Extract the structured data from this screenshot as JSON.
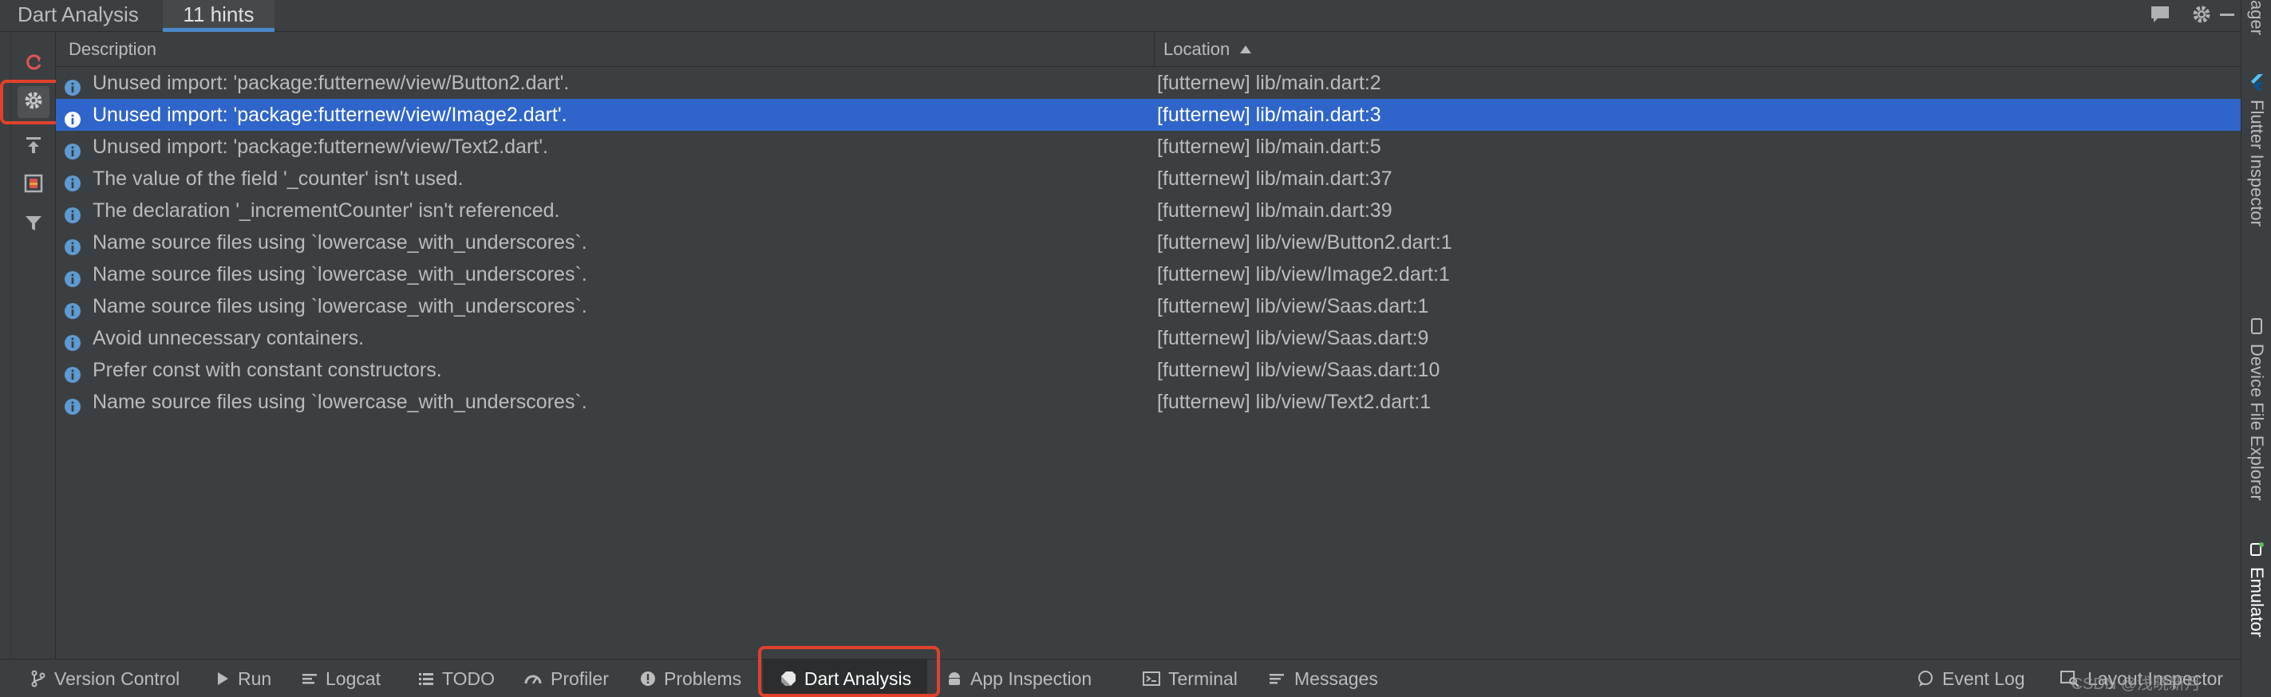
{
  "header": {
    "title": "Dart Analysis",
    "tab_label": "11 hints"
  },
  "header_icons": [
    "comment-icon",
    "gear-icon",
    "minimize-icon"
  ],
  "left_toolbar": [
    "refresh-icon",
    "gear-icon",
    "pin-icon",
    "preview-icon",
    "filter-icon"
  ],
  "table": {
    "columns": {
      "description": "Description",
      "location": "Location"
    },
    "sort_indicator": "ascending",
    "selected_row_index": 1,
    "rows": [
      {
        "description": "Unused import: 'package:futternew/view/Button2.dart'.",
        "location": "[futternew] lib/main.dart:2"
      },
      {
        "description": "Unused import: 'package:futternew/view/Image2.dart'.",
        "location": "[futternew] lib/main.dart:3"
      },
      {
        "description": "Unused import: 'package:futternew/view/Text2.dart'.",
        "location": "[futternew] lib/main.dart:5"
      },
      {
        "description": "The value of the field '_counter' isn't used.",
        "location": "[futternew] lib/main.dart:37"
      },
      {
        "description": "The declaration '_incrementCounter' isn't referenced.",
        "location": "[futternew] lib/main.dart:39"
      },
      {
        "description": "Name source files using `lowercase_with_underscores`.",
        "location": "[futternew] lib/view/Button2.dart:1"
      },
      {
        "description": "Name source files using `lowercase_with_underscores`.",
        "location": "[futternew] lib/view/Image2.dart:1"
      },
      {
        "description": "Name source files using `lowercase_with_underscores`.",
        "location": "[futternew] lib/view/Saas.dart:1"
      },
      {
        "description": "Avoid unnecessary containers.",
        "location": "[futternew] lib/view/Saas.dart:9"
      },
      {
        "description": "Prefer const with constant constructors.",
        "location": "[futternew] lib/view/Saas.dart:10"
      },
      {
        "description": "Name source files using `lowercase_with_underscores`.",
        "location": "[futternew] lib/view/Text2.dart:1"
      }
    ]
  },
  "right_bar": {
    "top_label": "ager",
    "flutter_inspector": "Flutter Inspector",
    "device_file_explorer": "Device File Explorer",
    "emulator": "Emulator"
  },
  "bottom_bar": {
    "version_control": "Version Control",
    "run": "Run",
    "logcat": "Logcat",
    "todo": "TODO",
    "profiler": "Profiler",
    "problems": "Problems",
    "dart_analysis": "Dart Analysis",
    "app_inspection": "App Inspection",
    "terminal": "Terminal",
    "messages": "Messages",
    "event_log": "Event Log",
    "layout_inspector": "Layout Inspector",
    "watermark": "CSDN @浅晓新月"
  },
  "colors": {
    "selection": "#2f65ca",
    "highlight_box": "#e0412c",
    "info_icon": "#5d9bd2",
    "tab_underline": "#4a88c7"
  }
}
